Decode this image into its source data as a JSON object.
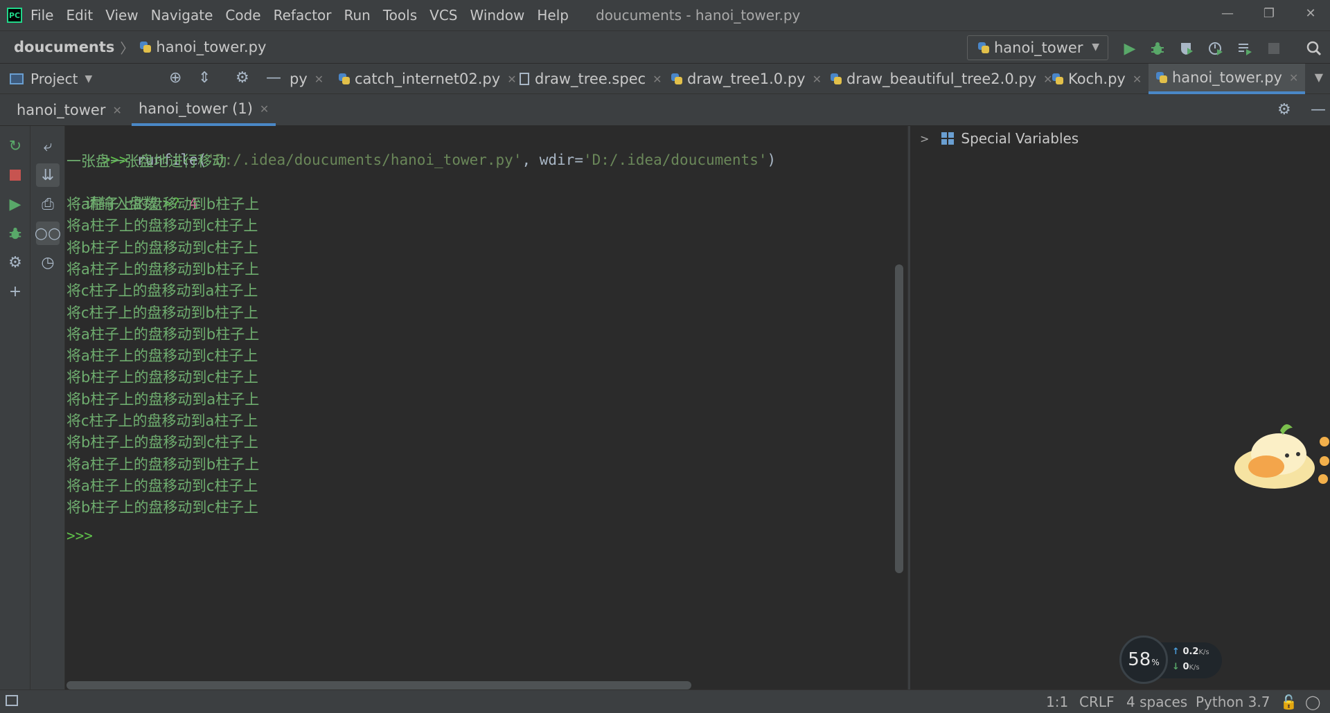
{
  "titlebar": {
    "app_logo": "PC",
    "menu": [
      "File",
      "Edit",
      "View",
      "Navigate",
      "Code",
      "Refactor",
      "Run",
      "Tools",
      "VCS",
      "Window",
      "Help"
    ],
    "window_title": "doucuments - hanoi_tower.py",
    "controls": {
      "minimize": "—",
      "restore": "❐",
      "close": "✕"
    }
  },
  "navbar": {
    "project": "doucuments",
    "separator": "〉",
    "file": "hanoi_tower.py",
    "run_config": "hanoi_tower",
    "icons": [
      "run-icon",
      "debug-icon",
      "coverage-icon",
      "profile-icon",
      "concurrency-icon",
      "stop-icon",
      "search-icon"
    ]
  },
  "project_tool": {
    "label": "Project"
  },
  "editor_tabs": [
    {
      "label": "py",
      "type": "py",
      "active": false
    },
    {
      "label": "catch_internet02.py",
      "type": "py",
      "active": false
    },
    {
      "label": "draw_tree.spec",
      "type": "text",
      "active": false
    },
    {
      "label": "draw_tree1.0.py",
      "type": "py",
      "active": false
    },
    {
      "label": "draw_beautiful_tree2.0.py",
      "type": "py",
      "active": false
    },
    {
      "label": "Koch.py",
      "type": "py",
      "active": false
    },
    {
      "label": "hanoi_tower.py",
      "type": "py",
      "active": true
    }
  ],
  "console_tabs": [
    {
      "label": "hanoi_tower",
      "active": false
    },
    {
      "label": "hanoi_tower (1)",
      "active": true
    }
  ],
  "console": {
    "command": {
      "prompt": ">>>",
      "fn": " runfile(",
      "path": "'D:/.idea/doucuments/hanoi_tower.py'",
      "sep": ", wdir=",
      "wdir": "'D:/.idea/doucuments'",
      "close": ")"
    },
    "intro": "一张盘一张盘地进行移动",
    "input_prompt": "请输入盘数:",
    "input_marker": ">? ",
    "input_value": "4",
    "moves": [
      "将a柱子上的盘移动到b柱子上",
      "将a柱子上的盘移动到c柱子上",
      "将b柱子上的盘移动到c柱子上",
      "将a柱子上的盘移动到b柱子上",
      "将c柱子上的盘移动到a柱子上",
      "将c柱子上的盘移动到b柱子上",
      "将a柱子上的盘移动到b柱子上",
      "将a柱子上的盘移动到c柱子上",
      "将b柱子上的盘移动到c柱子上",
      "将b柱子上的盘移动到a柱子上",
      "将c柱子上的盘移动到a柱子上",
      "将b柱子上的盘移动到c柱子上",
      "将a柱子上的盘移动到b柱子上",
      "将a柱子上的盘移动到c柱子上",
      "将b柱子上的盘移动到c柱子上"
    ],
    "final_prompt": ">>>"
  },
  "variables": {
    "special_vars": "Special Variables"
  },
  "net_meter": {
    "percent": "58",
    "percent_sign": "%",
    "up": "0.2",
    "up_unit": "K/s",
    "down": "0",
    "down_unit": "K/s"
  },
  "statusbar": {
    "position": "1:1",
    "line_sep": "CRLF",
    "indent": "4 spaces",
    "interpreter": "Python 3.7"
  },
  "colors": {
    "accent": "#4a88c7",
    "run_green": "#59a869",
    "stop_red": "#c75450",
    "output_green": "#6fae6f",
    "string_green": "#6a8759"
  }
}
